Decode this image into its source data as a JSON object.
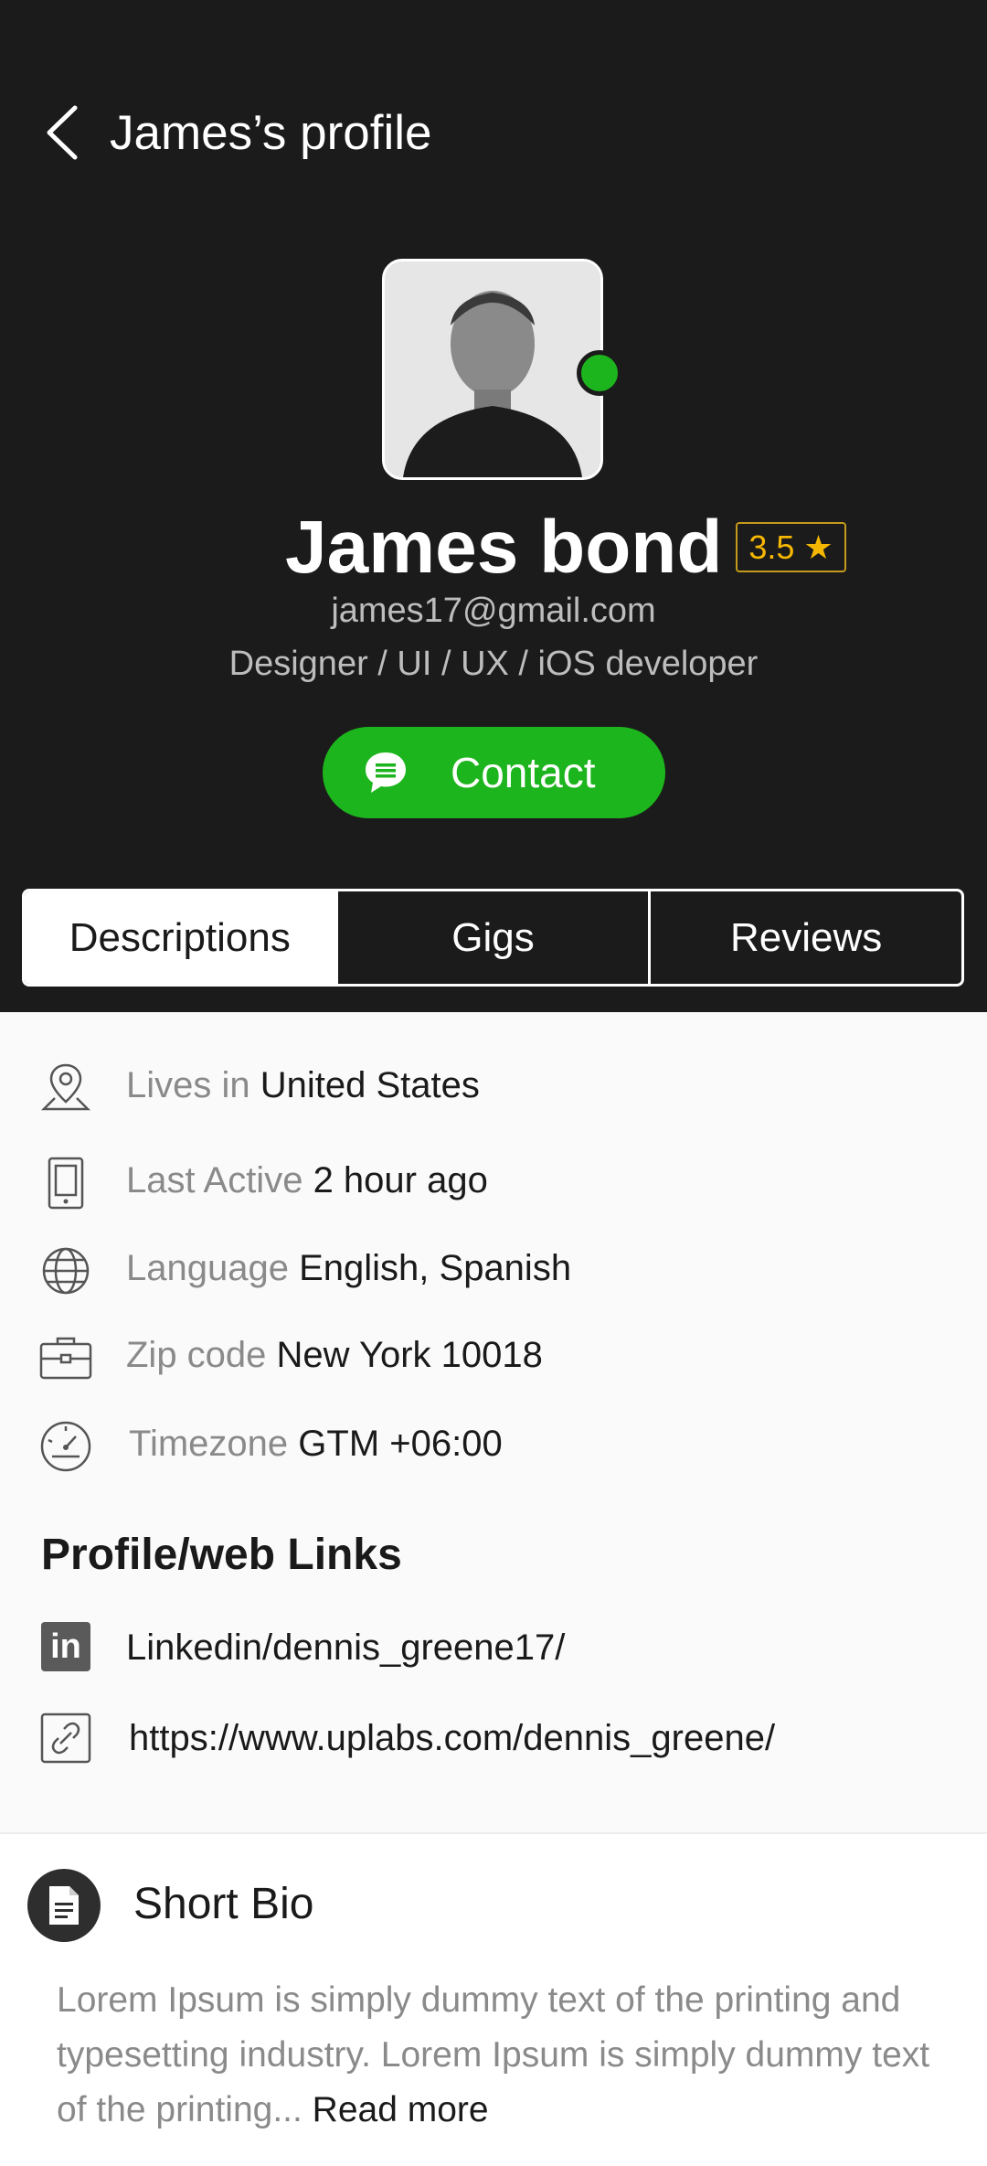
{
  "header": {
    "title": "James’s profile",
    "name": "James bond",
    "rating": "3.5",
    "email": "james17@gmail.com",
    "role": "Designer / UI / UX / iOS developer",
    "contact_label": "Contact",
    "status_color": "#1db51d"
  },
  "tabs": [
    {
      "label": "Descriptions",
      "active": true
    },
    {
      "label": "Gigs",
      "active": false
    },
    {
      "label": "Reviews",
      "active": false
    }
  ],
  "details": [
    {
      "icon": "location-pin-icon",
      "label": "Lives in",
      "value": "United States"
    },
    {
      "icon": "phone-icon",
      "label": "Last Active",
      "value": "2 hour ago"
    },
    {
      "icon": "globe-icon",
      "label": "Language",
      "value": "English, Spanish"
    },
    {
      "icon": "briefcase-icon",
      "label": "Zip code",
      "value": "New York 10018"
    },
    {
      "icon": "speedometer-icon",
      "label": "Timezone",
      "value": "GTM +06:00"
    }
  ],
  "links": {
    "title": "Profile/web Links",
    "items": [
      {
        "icon": "linkedin-icon",
        "text": "Linkedin/dennis_greene17/"
      },
      {
        "icon": "link-icon",
        "text": "https://www.uplabs.com/dennis_greene/"
      }
    ]
  },
  "bio": {
    "title": "Short Bio",
    "text": "Lorem Ipsum is simply dummy text of the printing and typesetting industry. Lorem Ipsum is simply dummy text of the printing... ",
    "read_more": "Read more"
  }
}
